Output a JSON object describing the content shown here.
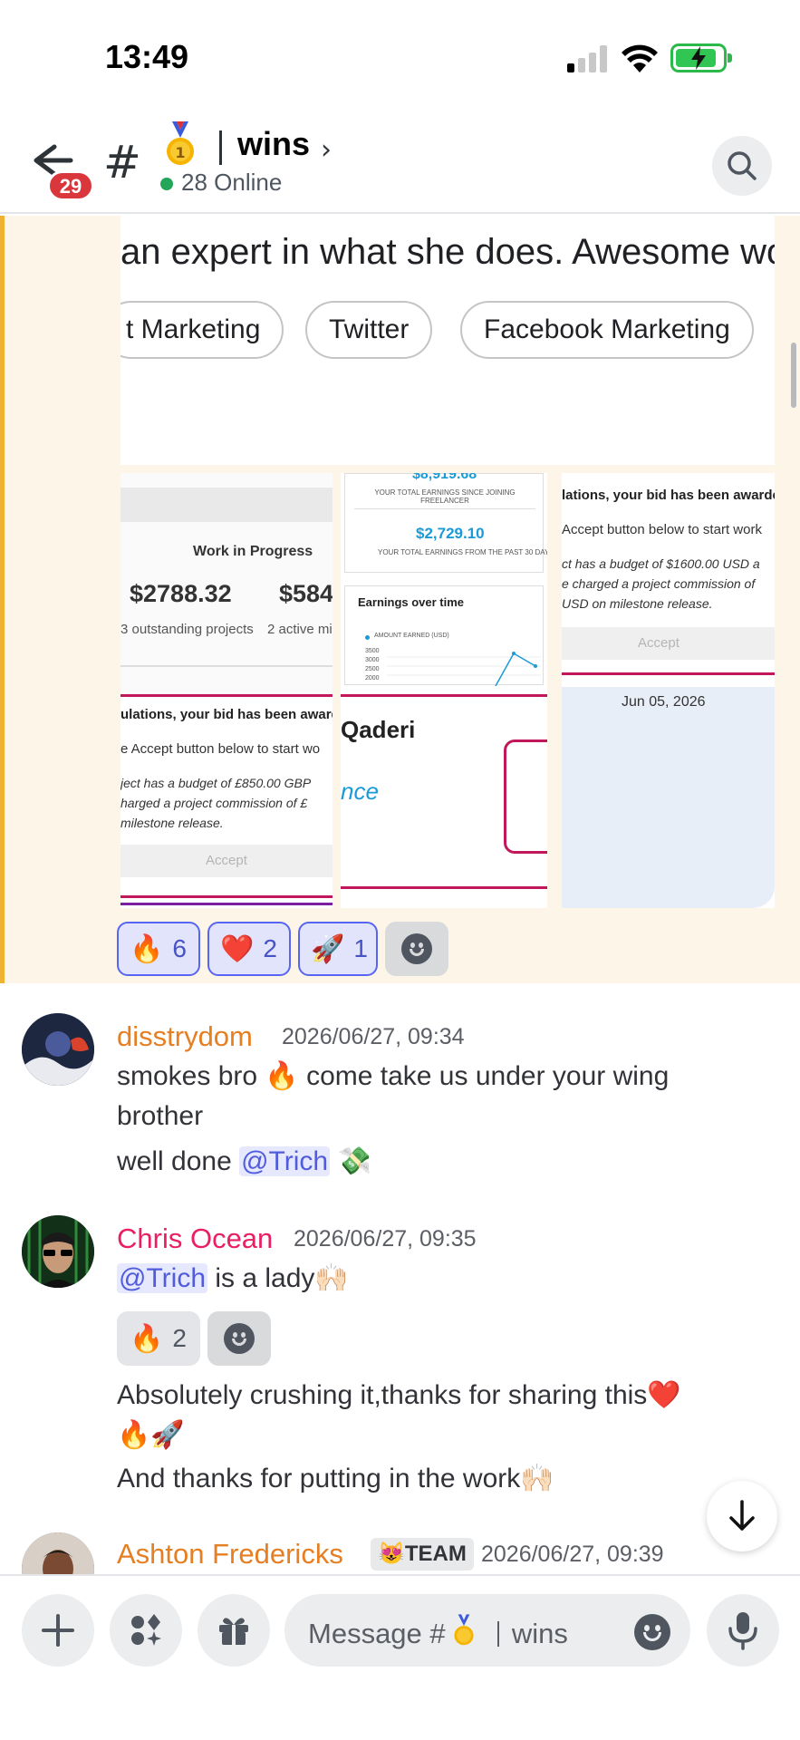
{
  "status_bar": {
    "time": "13:49"
  },
  "header": {
    "unread_badge": "29",
    "channel_name": "wins",
    "online_text": "28 Online"
  },
  "pinned_post": {
    "review_text": "an expert in what she does. Awesome wo",
    "tags": [
      "t Marketing",
      "Twitter",
      "Facebook Marketing"
    ],
    "work_in_progress": {
      "title": "Work in Progress",
      "amount_1": "$2788.32",
      "amount_2": "$584",
      "label_1": "3 outstanding projects",
      "label_2": "2 active mil"
    },
    "earnings": {
      "total_top": "$8,919.68",
      "total_top_label": "YOUR TOTAL EARNINGS SINCE JOINING FREELANCER",
      "month_total": "$2,729.10",
      "month_label": "YOUR TOTAL EARNINGS FROM THE PAST 30 DAYS",
      "chart_title": "Earnings over time",
      "legend": "AMOUNT EARNED (USD)",
      "y_ticks": [
        "3500",
        "3000",
        "2500",
        "2000"
      ]
    },
    "bid_1": {
      "title": "lations, your bid has been awarde",
      "line1": "Accept button below to start work",
      "line2": "ct has a budget of $1600.00 USD a",
      "line3": "e charged a project commission of",
      "line4": "USD on milestone release.",
      "button": "Accept"
    },
    "bid_2": {
      "title": "ulations, your bid has been award",
      "line1": "e Accept button below to start wo",
      "line2": "ject has a budget of £850.00 GBP",
      "line3": "harged a project commission of £",
      "line4": "milestone release.",
      "button": "Accept"
    },
    "profile_card": {
      "name": "Qaderi",
      "sub": "nce"
    },
    "date_card": {
      "date": "Jun 05, 2026"
    },
    "reactions": [
      {
        "emoji": "🔥",
        "count": "6"
      },
      {
        "emoji": "❤️",
        "count": "2"
      },
      {
        "emoji": "🚀",
        "count": "1"
      }
    ]
  },
  "messages": [
    {
      "author": "disstrydom",
      "author_color": "#e67e22",
      "timestamp": "2026/06/27, 09:34",
      "line1": "smokes bro 🔥 come take us under your wing",
      "line2": "brother",
      "line3_prefix": "well done ",
      "mention": "@Trich",
      "line3_suffix": " 💸"
    },
    {
      "author": "Chris Ocean",
      "author_color": "#e91e63",
      "timestamp": "2026/06/27, 09:35",
      "mention": "@Trich",
      "line1_suffix": " is a lady🙌🏻",
      "reaction": {
        "emoji": "🔥",
        "count": "2"
      },
      "line2": "Absolutely crushing it,thanks for sharing this❤️",
      "line3": "🔥🚀",
      "line4": "And thanks for putting in the work🙌🏻"
    },
    {
      "author": "Ashton Fredericks",
      "author_color": "#e67e22",
      "role": "😻TEAM",
      "timestamp": "2026/06/27, 09:39"
    }
  ],
  "composer": {
    "placeholder_prefix": "Message #",
    "placeholder_channel": "wins"
  }
}
